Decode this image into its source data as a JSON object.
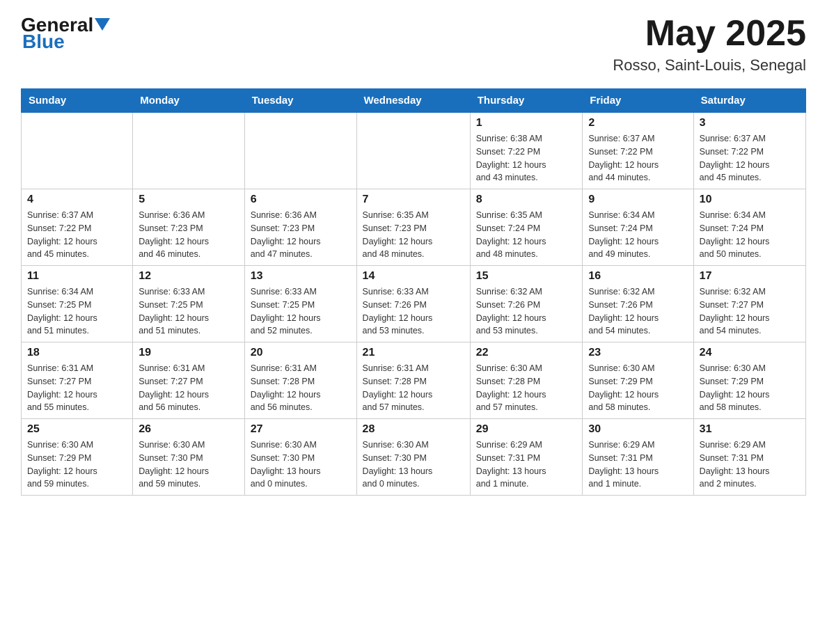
{
  "header": {
    "logo_general": "General",
    "logo_blue": "Blue",
    "month_title": "May 2025",
    "location": "Rosso, Saint-Louis, Senegal"
  },
  "days_of_week": [
    "Sunday",
    "Monday",
    "Tuesday",
    "Wednesday",
    "Thursday",
    "Friday",
    "Saturday"
  ],
  "weeks": [
    {
      "days": [
        {
          "number": "",
          "info": ""
        },
        {
          "number": "",
          "info": ""
        },
        {
          "number": "",
          "info": ""
        },
        {
          "number": "",
          "info": ""
        },
        {
          "number": "1",
          "info": "Sunrise: 6:38 AM\nSunset: 7:22 PM\nDaylight: 12 hours\nand 43 minutes."
        },
        {
          "number": "2",
          "info": "Sunrise: 6:37 AM\nSunset: 7:22 PM\nDaylight: 12 hours\nand 44 minutes."
        },
        {
          "number": "3",
          "info": "Sunrise: 6:37 AM\nSunset: 7:22 PM\nDaylight: 12 hours\nand 45 minutes."
        }
      ]
    },
    {
      "days": [
        {
          "number": "4",
          "info": "Sunrise: 6:37 AM\nSunset: 7:22 PM\nDaylight: 12 hours\nand 45 minutes."
        },
        {
          "number": "5",
          "info": "Sunrise: 6:36 AM\nSunset: 7:23 PM\nDaylight: 12 hours\nand 46 minutes."
        },
        {
          "number": "6",
          "info": "Sunrise: 6:36 AM\nSunset: 7:23 PM\nDaylight: 12 hours\nand 47 minutes."
        },
        {
          "number": "7",
          "info": "Sunrise: 6:35 AM\nSunset: 7:23 PM\nDaylight: 12 hours\nand 48 minutes."
        },
        {
          "number": "8",
          "info": "Sunrise: 6:35 AM\nSunset: 7:24 PM\nDaylight: 12 hours\nand 48 minutes."
        },
        {
          "number": "9",
          "info": "Sunrise: 6:34 AM\nSunset: 7:24 PM\nDaylight: 12 hours\nand 49 minutes."
        },
        {
          "number": "10",
          "info": "Sunrise: 6:34 AM\nSunset: 7:24 PM\nDaylight: 12 hours\nand 50 minutes."
        }
      ]
    },
    {
      "days": [
        {
          "number": "11",
          "info": "Sunrise: 6:34 AM\nSunset: 7:25 PM\nDaylight: 12 hours\nand 51 minutes."
        },
        {
          "number": "12",
          "info": "Sunrise: 6:33 AM\nSunset: 7:25 PM\nDaylight: 12 hours\nand 51 minutes."
        },
        {
          "number": "13",
          "info": "Sunrise: 6:33 AM\nSunset: 7:25 PM\nDaylight: 12 hours\nand 52 minutes."
        },
        {
          "number": "14",
          "info": "Sunrise: 6:33 AM\nSunset: 7:26 PM\nDaylight: 12 hours\nand 53 minutes."
        },
        {
          "number": "15",
          "info": "Sunrise: 6:32 AM\nSunset: 7:26 PM\nDaylight: 12 hours\nand 53 minutes."
        },
        {
          "number": "16",
          "info": "Sunrise: 6:32 AM\nSunset: 7:26 PM\nDaylight: 12 hours\nand 54 minutes."
        },
        {
          "number": "17",
          "info": "Sunrise: 6:32 AM\nSunset: 7:27 PM\nDaylight: 12 hours\nand 54 minutes."
        }
      ]
    },
    {
      "days": [
        {
          "number": "18",
          "info": "Sunrise: 6:31 AM\nSunset: 7:27 PM\nDaylight: 12 hours\nand 55 minutes."
        },
        {
          "number": "19",
          "info": "Sunrise: 6:31 AM\nSunset: 7:27 PM\nDaylight: 12 hours\nand 56 minutes."
        },
        {
          "number": "20",
          "info": "Sunrise: 6:31 AM\nSunset: 7:28 PM\nDaylight: 12 hours\nand 56 minutes."
        },
        {
          "number": "21",
          "info": "Sunrise: 6:31 AM\nSunset: 7:28 PM\nDaylight: 12 hours\nand 57 minutes."
        },
        {
          "number": "22",
          "info": "Sunrise: 6:30 AM\nSunset: 7:28 PM\nDaylight: 12 hours\nand 57 minutes."
        },
        {
          "number": "23",
          "info": "Sunrise: 6:30 AM\nSunset: 7:29 PM\nDaylight: 12 hours\nand 58 minutes."
        },
        {
          "number": "24",
          "info": "Sunrise: 6:30 AM\nSunset: 7:29 PM\nDaylight: 12 hours\nand 58 minutes."
        }
      ]
    },
    {
      "days": [
        {
          "number": "25",
          "info": "Sunrise: 6:30 AM\nSunset: 7:29 PM\nDaylight: 12 hours\nand 59 minutes."
        },
        {
          "number": "26",
          "info": "Sunrise: 6:30 AM\nSunset: 7:30 PM\nDaylight: 12 hours\nand 59 minutes."
        },
        {
          "number": "27",
          "info": "Sunrise: 6:30 AM\nSunset: 7:30 PM\nDaylight: 13 hours\nand 0 minutes."
        },
        {
          "number": "28",
          "info": "Sunrise: 6:30 AM\nSunset: 7:30 PM\nDaylight: 13 hours\nand 0 minutes."
        },
        {
          "number": "29",
          "info": "Sunrise: 6:29 AM\nSunset: 7:31 PM\nDaylight: 13 hours\nand 1 minute."
        },
        {
          "number": "30",
          "info": "Sunrise: 6:29 AM\nSunset: 7:31 PM\nDaylight: 13 hours\nand 1 minute."
        },
        {
          "number": "31",
          "info": "Sunrise: 6:29 AM\nSunset: 7:31 PM\nDaylight: 13 hours\nand 2 minutes."
        }
      ]
    }
  ]
}
